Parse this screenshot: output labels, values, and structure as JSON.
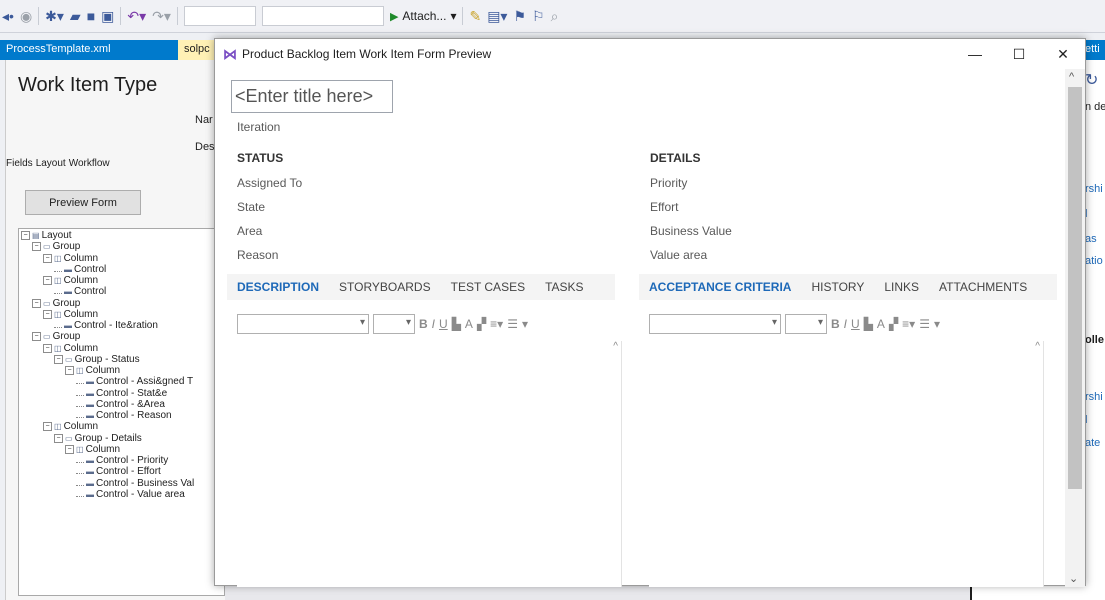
{
  "toolbar": {
    "attach_label": "Attach..."
  },
  "doc_tabs": {
    "active": "ProcessTemplate.xml",
    "solution": "solpc"
  },
  "editor": {
    "title": "Work Item Type",
    "name_frag": "Nar",
    "desc_frag": "Des",
    "tabs": [
      "Fields",
      "Layout",
      "Workflow"
    ],
    "preview_button": "Preview Form",
    "tree": [
      {
        "label": "Layout",
        "depth": 0,
        "toggle": "−",
        "icon": "layout"
      },
      {
        "label": "Group",
        "depth": 1,
        "toggle": "−",
        "icon": "group"
      },
      {
        "label": "Column",
        "depth": 2,
        "toggle": "−",
        "icon": "column"
      },
      {
        "label": "Control",
        "depth": 3,
        "toggle": "",
        "icon": "control"
      },
      {
        "label": "Column",
        "depth": 2,
        "toggle": "−",
        "icon": "column"
      },
      {
        "label": "Control",
        "depth": 3,
        "toggle": "",
        "icon": "control"
      },
      {
        "label": "Group",
        "depth": 1,
        "toggle": "−",
        "icon": "group"
      },
      {
        "label": "Column",
        "depth": 2,
        "toggle": "−",
        "icon": "column"
      },
      {
        "label": "Control - Ite&ration",
        "depth": 3,
        "toggle": "",
        "icon": "control"
      },
      {
        "label": "Group",
        "depth": 1,
        "toggle": "−",
        "icon": "group"
      },
      {
        "label": "Column",
        "depth": 2,
        "toggle": "−",
        "icon": "column"
      },
      {
        "label": "Group - Status",
        "depth": 3,
        "toggle": "−",
        "icon": "group"
      },
      {
        "label": "Column",
        "depth": 4,
        "toggle": "−",
        "icon": "column"
      },
      {
        "label": "Control - Assi&gned T",
        "depth": 5,
        "toggle": "",
        "icon": "control"
      },
      {
        "label": "Control - Stat&e",
        "depth": 5,
        "toggle": "",
        "icon": "control"
      },
      {
        "label": "Control - &Area",
        "depth": 5,
        "toggle": "",
        "icon": "control"
      },
      {
        "label": "Control - Reason",
        "depth": 5,
        "toggle": "",
        "icon": "control"
      },
      {
        "label": "Column",
        "depth": 2,
        "toggle": "−",
        "icon": "column"
      },
      {
        "label": "Group - Details",
        "depth": 3,
        "toggle": "−",
        "icon": "group"
      },
      {
        "label": "Column",
        "depth": 4,
        "toggle": "−",
        "icon": "column"
      },
      {
        "label": "Control - Priority",
        "depth": 5,
        "toggle": "",
        "icon": "control"
      },
      {
        "label": "Control - Effort",
        "depth": 5,
        "toggle": "",
        "icon": "control"
      },
      {
        "label": "Control - Business Val",
        "depth": 5,
        "toggle": "",
        "icon": "control"
      },
      {
        "label": "Control - Value area",
        "depth": 5,
        "toggle": "",
        "icon": "control"
      }
    ]
  },
  "right_panel": {
    "header": "etti",
    "lines": [
      "n de",
      "rshi",
      "l",
      "as",
      "atio",
      "olle",
      "rshi",
      "l",
      "ate"
    ]
  },
  "dialog": {
    "title": "Product Backlog Item Work Item Form Preview",
    "title_placeholder": "<Enter title here>",
    "iteration_label": "Iteration",
    "status": {
      "header": "STATUS",
      "fields": [
        "Assigned To",
        "State",
        "Area",
        "Reason"
      ]
    },
    "details": {
      "header": "DETAILS",
      "fields": [
        "Priority",
        "Effort",
        "Business Value",
        "Value area"
      ]
    },
    "left_tabs": [
      "DESCRIPTION",
      "STORYBOARDS",
      "TEST CASES",
      "TASKS"
    ],
    "right_tabs": [
      "ACCEPTANCE CRITERIA",
      "HISTORY",
      "LINKS",
      "ATTACHMENTS"
    ],
    "selected_left_tab": "DESCRIPTION",
    "selected_right_tab": "ACCEPTANCE CRITERIA"
  }
}
